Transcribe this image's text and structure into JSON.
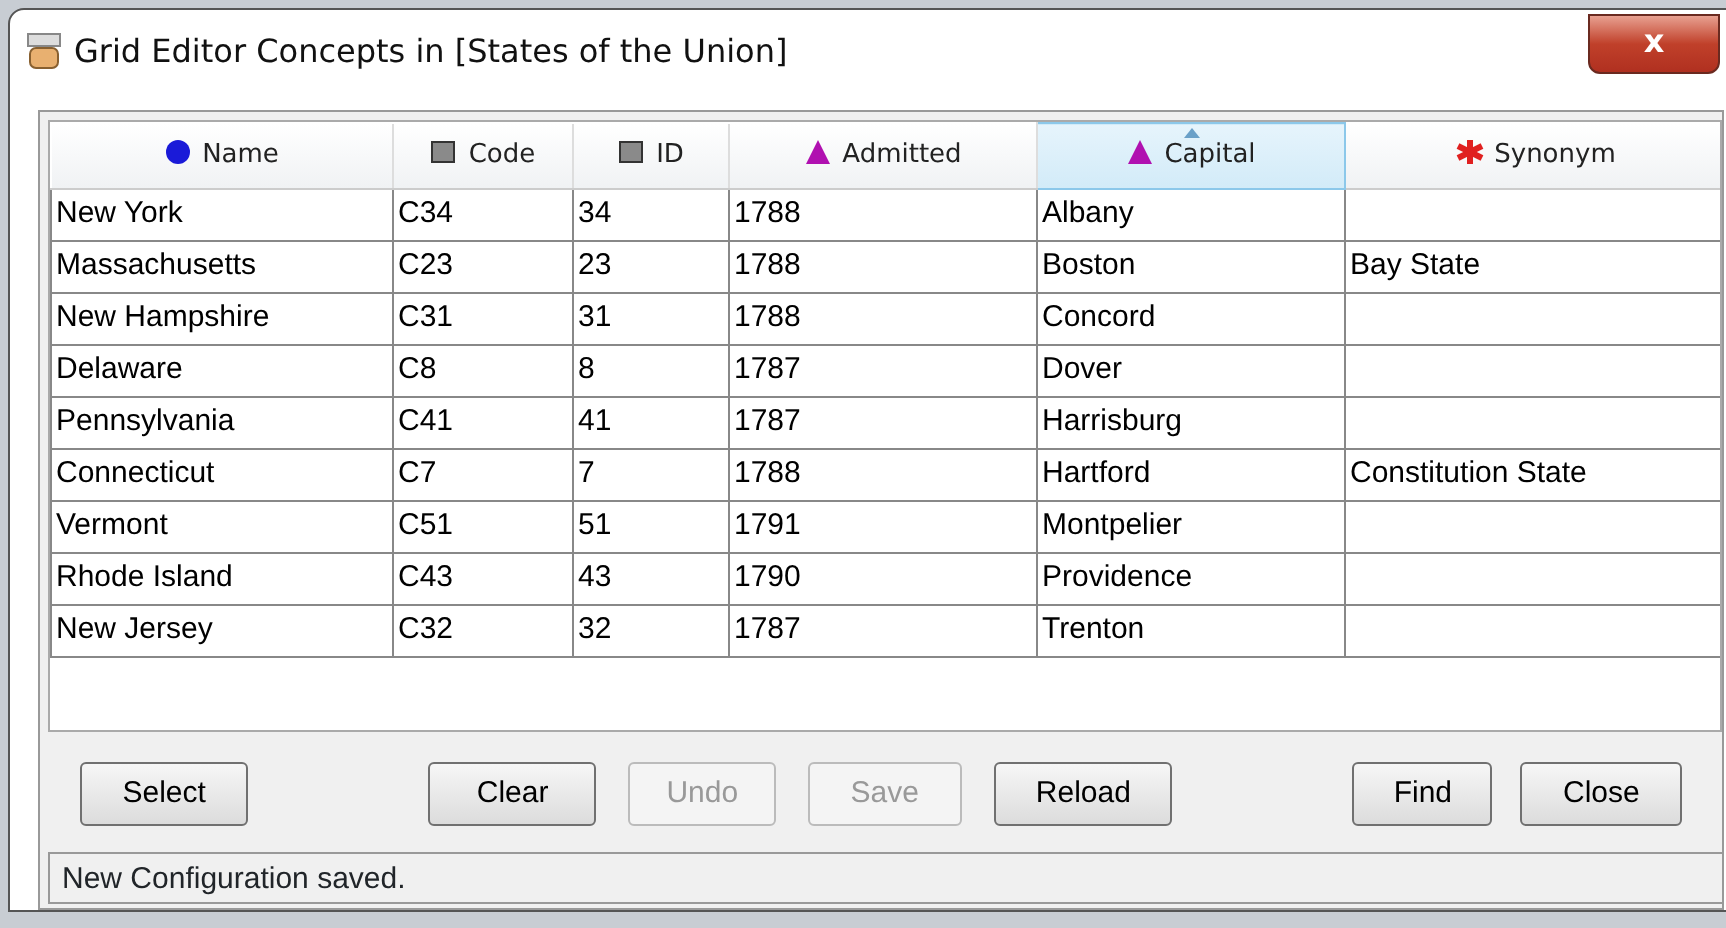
{
  "window": {
    "title": "Grid Editor Concepts in [States of the Union]",
    "close_label": "x"
  },
  "table": {
    "columns": [
      {
        "label": "Name",
        "kind": "sphere",
        "color": "#1a1ad8",
        "sorted": false
      },
      {
        "label": "Code",
        "kind": "square",
        "color": "#8a8a8a",
        "sorted": false
      },
      {
        "label": "ID",
        "kind": "square",
        "color": "#8a8a8a",
        "sorted": false
      },
      {
        "label": "Admitted",
        "kind": "pyramid",
        "color": "#b010b0",
        "sorted": false
      },
      {
        "label": "Capital",
        "kind": "pyramid",
        "color": "#b010b0",
        "sorted": true
      },
      {
        "label": "Synonym",
        "kind": "asterisk",
        "color": "#e02020",
        "sorted": false
      }
    ],
    "rows": [
      [
        "New York",
        "C34",
        "34",
        "1788",
        "Albany",
        ""
      ],
      [
        "Massachusetts",
        "C23",
        "23",
        "1788",
        "Boston",
        "Bay State"
      ],
      [
        "New Hampshire",
        "C31",
        "31",
        "1788",
        "Concord",
        ""
      ],
      [
        "Delaware",
        "C8",
        "8",
        "1787",
        "Dover",
        ""
      ],
      [
        "Pennsylvania",
        "C41",
        "41",
        "1787",
        "Harrisburg",
        ""
      ],
      [
        "Connecticut",
        "C7",
        "7",
        "1788",
        "Hartford",
        "Constitution State"
      ],
      [
        "Vermont",
        "C51",
        "51",
        "1791",
        "Montpelier",
        ""
      ],
      [
        "Rhode Island",
        "C43",
        "43",
        "1790",
        "Providence",
        ""
      ],
      [
        "New Jersey",
        "C32",
        "32",
        "1787",
        "Trenton",
        ""
      ]
    ]
  },
  "buttons": [
    {
      "label": "Select",
      "disabled": false
    },
    {
      "label": "Clear",
      "disabled": false
    },
    {
      "label": "Undo",
      "disabled": true
    },
    {
      "label": "Save",
      "disabled": true
    },
    {
      "label": "Reload",
      "disabled": false
    },
    {
      "label": "Find",
      "disabled": false
    },
    {
      "label": "Close",
      "disabled": false
    }
  ],
  "status_bar": "New Configuration saved."
}
